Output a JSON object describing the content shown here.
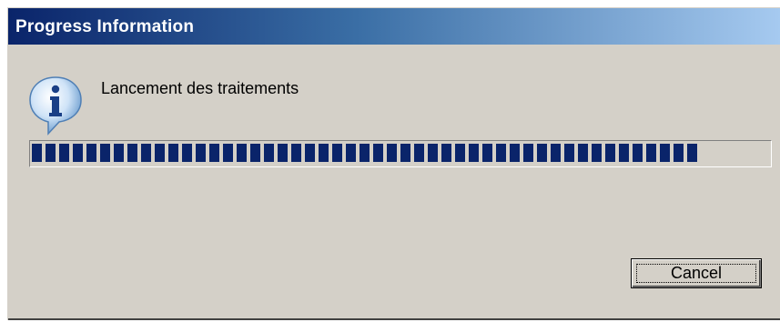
{
  "window": {
    "title": "Progress Information"
  },
  "content": {
    "icon": "info-icon",
    "message": "Lancement des traitements"
  },
  "progress": {
    "fraction": 0.92
  },
  "buttons": {
    "cancel_label": "Cancel"
  },
  "colors": {
    "title_start": "#0a246a",
    "title_end": "#a6caf0",
    "window_bg": "#d4d0c8",
    "progress_fill": "#0a246a"
  }
}
